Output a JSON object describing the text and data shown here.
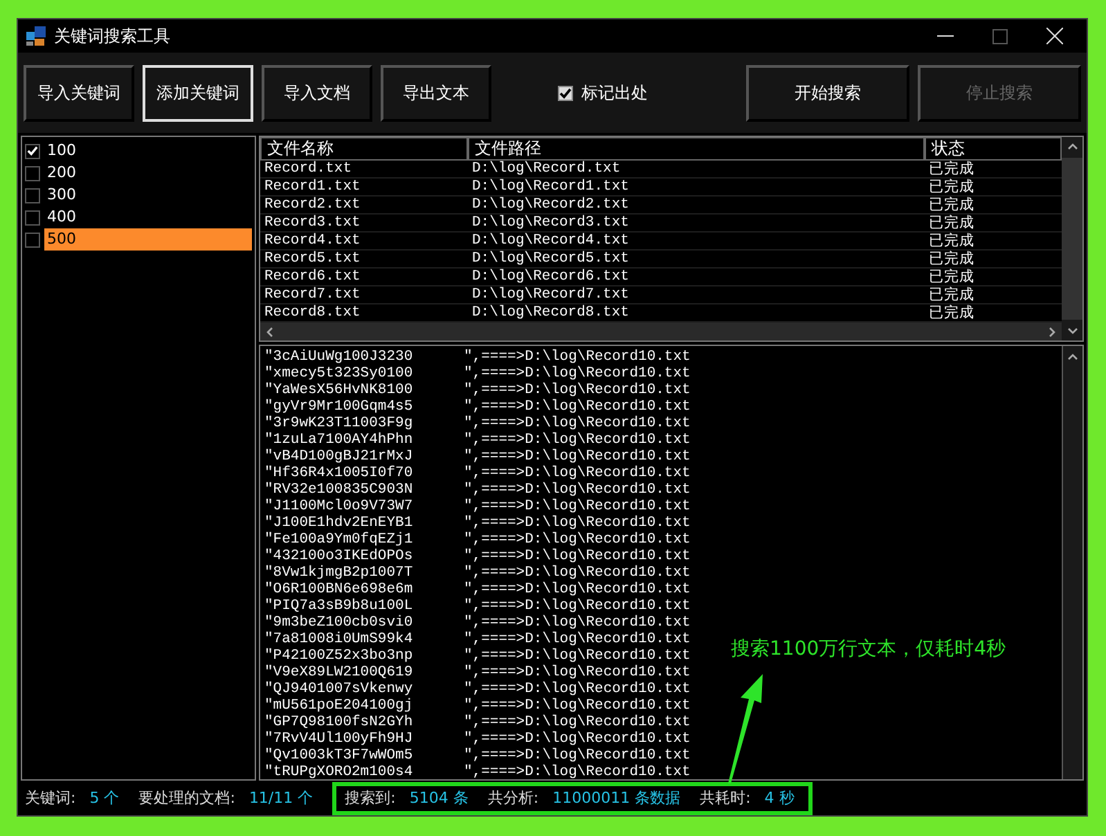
{
  "window": {
    "title": "关键词搜索工具"
  },
  "toolbar": {
    "buttons": [
      {
        "label": "导入关键词",
        "focused": false,
        "disabled": false
      },
      {
        "label": "添加关键词",
        "focused": true,
        "disabled": false
      },
      {
        "label": "导入文档",
        "focused": false,
        "disabled": false
      },
      {
        "label": "导出文本",
        "focused": false,
        "disabled": false
      }
    ],
    "mark_source": {
      "label": "标记出处",
      "checked": true
    },
    "actions": [
      {
        "label": "开始搜索",
        "disabled": false
      },
      {
        "label": "停止搜索",
        "disabled": true
      }
    ]
  },
  "keywords": [
    {
      "label": "100",
      "checked": true,
      "selected": false
    },
    {
      "label": "200",
      "checked": false,
      "selected": false
    },
    {
      "label": "300",
      "checked": false,
      "selected": false
    },
    {
      "label": "400",
      "checked": false,
      "selected": false
    },
    {
      "label": "500",
      "checked": false,
      "selected": true
    }
  ],
  "files": {
    "columns": [
      "文件名称",
      "文件路径",
      "状态"
    ],
    "rows": [
      [
        "Record.txt",
        "D:\\log\\Record.txt",
        "已完成"
      ],
      [
        "Record1.txt",
        "D:\\log\\Record1.txt",
        "已完成"
      ],
      [
        "Record2.txt",
        "D:\\log\\Record2.txt",
        "已完成"
      ],
      [
        "Record3.txt",
        "D:\\log\\Record3.txt",
        "已完成"
      ],
      [
        "Record4.txt",
        "D:\\log\\Record4.txt",
        "已完成"
      ],
      [
        "Record5.txt",
        "D:\\log\\Record5.txt",
        "已完成"
      ],
      [
        "Record6.txt",
        "D:\\log\\Record6.txt",
        "已完成"
      ],
      [
        "Record7.txt",
        "D:\\log\\Record7.txt",
        "已完成"
      ],
      [
        "Record8.txt",
        "D:\\log\\Record8.txt",
        "已完成"
      ]
    ]
  },
  "results": [
    {
      "match": "\"3cAiUuWg100J3230",
      "target": "\",====>D:\\log\\Record10.txt"
    },
    {
      "match": "\"xmecy5t323Sy0100",
      "target": "\",====>D:\\log\\Record10.txt"
    },
    {
      "match": "\"YaWesX56HvNK8100",
      "target": "\",====>D:\\log\\Record10.txt"
    },
    {
      "match": "\"gyVr9Mr100Gqm4s5",
      "target": "\",====>D:\\log\\Record10.txt"
    },
    {
      "match": "\"3r9wK23T11003F9g",
      "target": "\",====>D:\\log\\Record10.txt"
    },
    {
      "match": "\"1zuLa7100AY4hPhn",
      "target": "\",====>D:\\log\\Record10.txt"
    },
    {
      "match": "\"vB4D100gBJ21rMxJ",
      "target": "\",====>D:\\log\\Record10.txt"
    },
    {
      "match": "\"Hf36R4x1005I0f70",
      "target": "\",====>D:\\log\\Record10.txt"
    },
    {
      "match": "\"RV32e100835C903N",
      "target": "\",====>D:\\log\\Record10.txt"
    },
    {
      "match": "\"J1100Mcl0o9V73W7",
      "target": "\",====>D:\\log\\Record10.txt"
    },
    {
      "match": "\"J100E1hdv2EnEYB1",
      "target": "\",====>D:\\log\\Record10.txt"
    },
    {
      "match": "\"Fe100a9Ym0fqEZj1",
      "target": "\",====>D:\\log\\Record10.txt"
    },
    {
      "match": "\"432100o3IKEdOPOs",
      "target": "\",====>D:\\log\\Record10.txt"
    },
    {
      "match": "\"8Vw1kjmgB2p1007T",
      "target": "\",====>D:\\log\\Record10.txt"
    },
    {
      "match": "\"O6R100BN6e698e6m",
      "target": "\",====>D:\\log\\Record10.txt"
    },
    {
      "match": "\"PIQ7a3sB9b8u100L",
      "target": "\",====>D:\\log\\Record10.txt"
    },
    {
      "match": "\"9m3beZ100cb0svi0",
      "target": "\",====>D:\\log\\Record10.txt"
    },
    {
      "match": "\"7a81008i0UmS99k4",
      "target": "\",====>D:\\log\\Record10.txt"
    },
    {
      "match": "\"P42100Z52x3bo3np",
      "target": "\",====>D:\\log\\Record10.txt"
    },
    {
      "match": "\"V9eX89LW2100Q619",
      "target": "\",====>D:\\log\\Record10.txt"
    },
    {
      "match": "\"QJ9401007sVkenwy",
      "target": "\",====>D:\\log\\Record10.txt"
    },
    {
      "match": "\"mU561poE204100gj",
      "target": "\",====>D:\\log\\Record10.txt"
    },
    {
      "match": "\"GP7Q98100fsN2GYh",
      "target": "\",====>D:\\log\\Record10.txt"
    },
    {
      "match": "\"7RvV4Ul100yFh9HJ",
      "target": "\",====>D:\\log\\Record10.txt"
    },
    {
      "match": "\"Qv1003kT3F7wWOm5",
      "target": "\",====>D:\\log\\Record10.txt"
    },
    {
      "match": "\"tRUPgXORO2m100s4",
      "target": "\",====>D:\\log\\Record10.txt"
    }
  ],
  "annotation": {
    "text": "搜索1100万行文本，仅耗时4秒"
  },
  "status_bar": {
    "items": [
      {
        "label": "关键词:",
        "value": "5 个"
      },
      {
        "label": "要处理的文档:",
        "value": "11/11 个"
      }
    ],
    "highlighted": [
      {
        "label": "搜索到:",
        "value": "5104 条"
      },
      {
        "label": "共分析:",
        "value": "11000011 条数据"
      },
      {
        "label": "共耗时:",
        "value": "4 秒"
      }
    ]
  }
}
